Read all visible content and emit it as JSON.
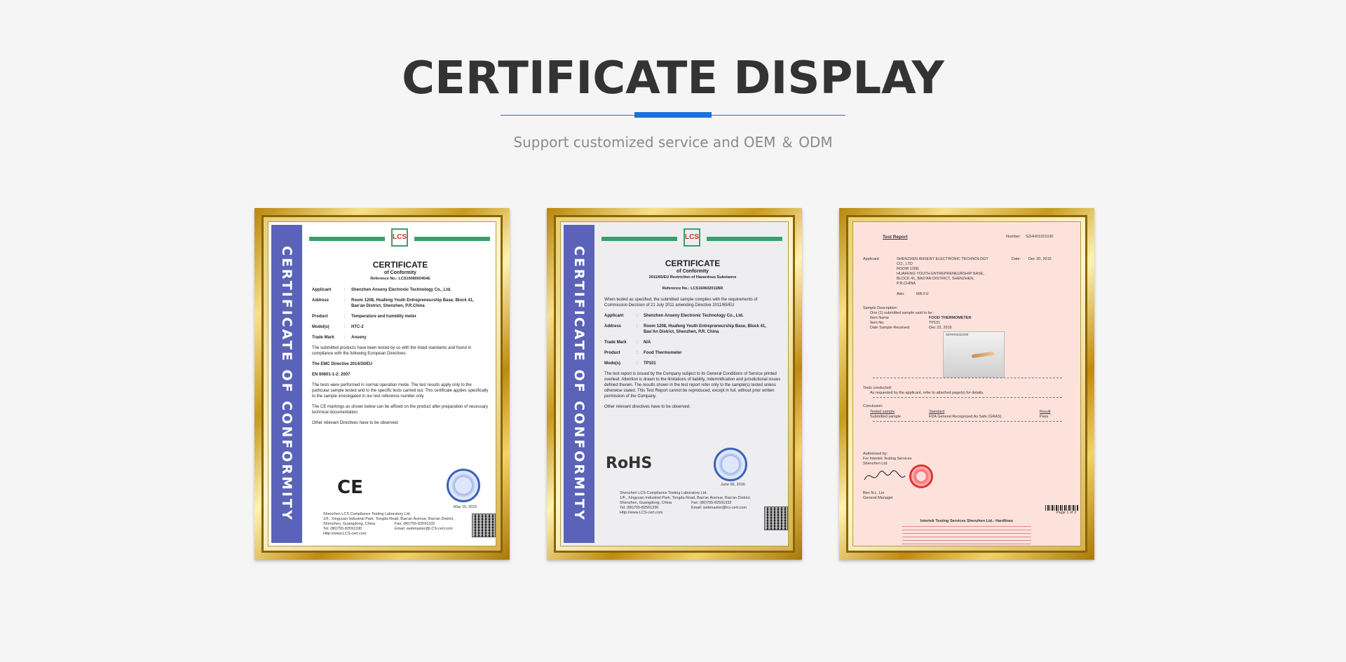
{
  "header": {
    "title": "CERTIFICATE DISPLAY",
    "subtitle": "Support customized service and OEM ＆ ODM"
  },
  "colors": {
    "accent": "#1a73d9",
    "background": "#f5f5f5",
    "sideband": "#5a63b8",
    "frame_gold": "#c79a1e"
  },
  "certificates": [
    {
      "side_text": "CERTIFICATE OF CONFORMITY",
      "logo": "LCS",
      "title": "CERTIFICATE",
      "subtitle": "of Conformity",
      "reference": "Reference No.: LCS1508060454E",
      "fields": [
        {
          "k": "Applicant",
          "v": "Shenzhen Anseny Electronic Technology Co., Ltd."
        },
        {
          "k": "Address",
          "v": "Room 1208, Huafeng Youth Entrepreneurship Base, Block 41, Bao'an District, Shenzhen, P.R.China"
        },
        {
          "k": "Product",
          "v": "Temperature and humidity meter"
        },
        {
          "k": "Model(s)",
          "v": "HTC-2"
        },
        {
          "k": "Trade Mark",
          "v": "Anseny"
        }
      ],
      "para1": "The submitted products have been tested by us with the listed standards and found in compliance with the following European Directives:",
      "directive": "The EMC Directive 2014/30/EU",
      "standard": "EN 60601-1-2: 2007",
      "para2": "The tests were performed in normal operation mode. The test results apply only to the particular sample tested and to the specific tests carried out. This certificate applies specifically to the sample investigated in our test reference number only.",
      "para3": "The CE markings as shown below can be affixed on the product after preparation of necessary technical documentation.",
      "para4": "Other relevant Directives have to be observed.",
      "mark": "CE",
      "date": "May 16, 2015",
      "footer_left": "Shenzhen LCS Compliance Testing Laboratory Ltd.\n1/F., Xingyuan Industrial Park, Tongda Road, Bao'an Avenue, Bao'an District, Shenzhen, Guangdong, China\nTel: (86)755-82591330\nHttp://www.LCS-cert.com",
      "footer_right": "Fax: (86)755-82591332\nEmail: webmaster@LCS-cert.com"
    },
    {
      "side_text": "CERTIFICATE OF CONFORMITY",
      "logo": "LCS",
      "title": "CERTIFICATE",
      "subtitle": "of Conformity",
      "directive_line": "2011/65/EU Restriction of Hazardous Substance",
      "reference": "Reference No.: LCS160602011BR",
      "intro": "When tested as specified, the submitted sample complies with the requirements of Commission Decision of 21 July 2011 amending Directive 2011/65/EU",
      "fields": [
        {
          "k": "Applicant",
          "v": "Shenzhen Anseny Electronic Technology Co., Ltd."
        },
        {
          "k": "Address",
          "v": "Room 1208, Huafeng Youth Entrepreneurship Base, Block 41, Bao'An District, Shenzhen, P.R. China"
        },
        {
          "k": "Trade Mark",
          "v": "N/A"
        },
        {
          "k": "Product",
          "v": "Food Thermometer"
        },
        {
          "k": "Mode(s)",
          "v": "TP101"
        }
      ],
      "para1": "The test report is issued by the Company subject to its General Conditions of Service printed overleaf. Attention is drawn to the limitations of liability, indemnification and jurisdictional issues defined therein. The results shown in the test report refer only to the sample(s) tested unless otherwise stated. This Test Report cannot be reproduced, except in full, without prior written permission of the Company.",
      "para2": "Other relevant directives have to be observed.",
      "mark": "RoHS",
      "date": "June 06, 2016",
      "footer_left": "Shenzhen LCS Compliance Testing Laboratory Ltd.\n1/F., Xingyuan Industrial Park, Tongda Road, Bao'an Avenue, Bao'an District,\nShenzhen, Guangdong, China\nTel: (86)755-82591330\nHttp://www.LCS-cert.com",
      "footer_right": "Fax: (86)755-82591332\nEmail: webmaster@lcs-cert.com"
    },
    {
      "heading": "Test Report",
      "number_label": "Number:",
      "number": "SZHH01021030",
      "applicant_label": "Applicant:",
      "applicant": "SHENZHEN ANSENY ELECTRONIC TECHNOLOGY CO., LTD\nROOM 1208,\nHUAFENG YOUTH ENTREPRENEURSHIP BASE,\nBLOCK 41, BAO'AN DISTRICT, SHENZHEN,\nP.R.CHINA",
      "date_label": "Date:",
      "date": "Dec 30, 2015",
      "attn_label": "Attn:",
      "attn": "MR.FU",
      "sample_label": "Sample Description:",
      "sample_intro": "One (1) submitted sample said to be :",
      "sample_rows": [
        {
          "k": "Item Name",
          "v": "FOOD THERMOMETER"
        },
        {
          "k": "Item No.",
          "v": "TP101"
        },
        {
          "k": "Date Sample Received",
          "v": "Dec 23, 2015"
        }
      ],
      "photo_label": "SZHH01021030",
      "tests_label": "Tests conducted:",
      "tests_text": "As requested by the applicant, refer to attached page(s) for details.",
      "conclusion_label": "Conclusion:",
      "conclusion_headers": [
        "Tested sample",
        "Standard",
        "Result"
      ],
      "conclusion_row": [
        "Submitted sample",
        "FDA General Recognized As Safe (GRAS)",
        "Pass"
      ],
      "auth_label": "Authorized by:",
      "auth_org": "For Intertek Testing Services\nShenzhen Ltd.",
      "signer": "Ben N.L. Lin\nGeneral Manager",
      "page": "Page 1 of 2",
      "footer_title": "Intertek Testing Services Shenzhen Ltd.- Hardlines"
    }
  ]
}
